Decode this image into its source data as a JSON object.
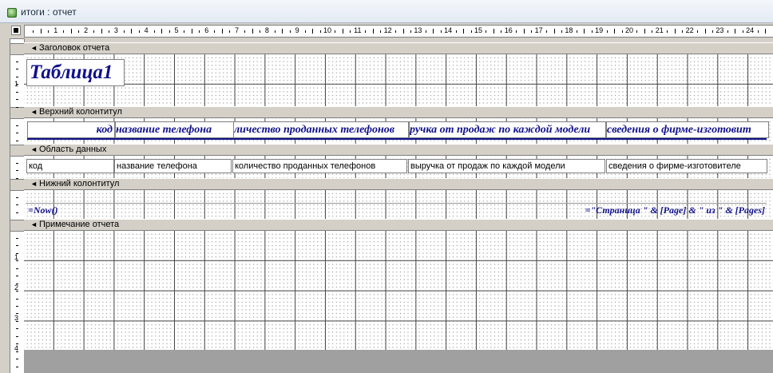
{
  "window": {
    "title": "итоги : отчет"
  },
  "ruler": {
    "h_labels": [
      "1",
      "2",
      "3",
      "4",
      "5",
      "6",
      "7",
      "8",
      "9",
      "10",
      "11",
      "12",
      "13",
      "14",
      "15",
      "16",
      "17",
      "18",
      "19",
      "20",
      "21",
      "22",
      "23",
      "24"
    ],
    "v_labels": [
      "1",
      "1",
      "2",
      "3",
      "4"
    ]
  },
  "sections": {
    "report_header": "Заголовок отчета",
    "page_header": "Верхний колонтитул",
    "detail": "Область данных",
    "page_footer": "Нижний колонтитул",
    "report_footer": "Примечание отчета"
  },
  "report_title": "Таблица1",
  "page_header_labels": [
    "код",
    "название телефона",
    "личество проданных телефонов",
    "ручка от продаж по каждой модели",
    "сведения о фирме-изготовит"
  ],
  "detail_fields": [
    "код",
    "название телефона",
    "количество проданных телефонов",
    "выручка от продаж по каждой модели",
    "сведения о фирме-изготовителе"
  ],
  "footer": {
    "left_expr": "=Now()",
    "right_expr": "=\"Страница \" & [Page] & \" из \" & [Pages]"
  },
  "colors": {
    "label_text": "#10108a",
    "grid_line": "#444444",
    "title_bar": "#e3eaf3"
  },
  "icons": {
    "window_icon": "database-report-icon",
    "section_arrow": "section-arrow-icon",
    "selector": "report-selector-icon"
  }
}
